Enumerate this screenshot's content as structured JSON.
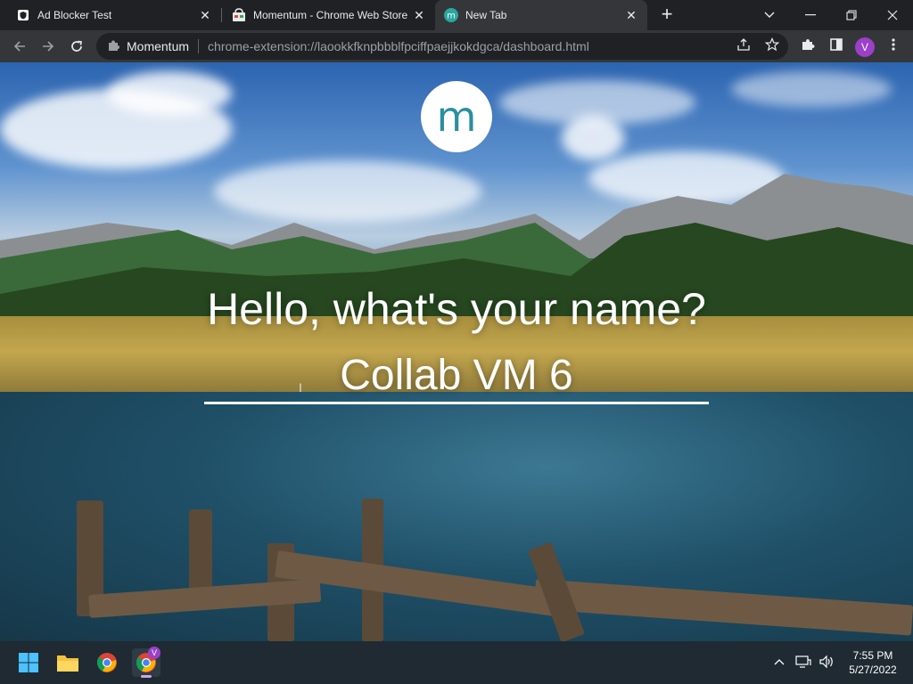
{
  "tabs": [
    {
      "title": "Ad Blocker Test",
      "icon": "shield-icon"
    },
    {
      "title": "Momentum - Chrome Web Store",
      "icon": "webstore-icon"
    },
    {
      "title": "New Tab",
      "icon": "momentum-icon",
      "active": true
    }
  ],
  "omnibox": {
    "site_label": "Momentum",
    "url": "chrome-extension://laookkfknpbbblfpciffpaejjkokdgca/dashboard.html"
  },
  "profile": {
    "initial": "V"
  },
  "page": {
    "logo_letter": "m",
    "greeting": "Hello, what's your name?",
    "name_value": "Collab VM 6"
  },
  "taskbar": {
    "time": "7:55 PM",
    "date": "5/27/2022",
    "badge": "V"
  },
  "colors": {
    "tab_bg": "#202124",
    "active_tab_bg": "#35363a",
    "avatar": "#9c3fc9",
    "momentum_teal": "#2a8fa0"
  }
}
